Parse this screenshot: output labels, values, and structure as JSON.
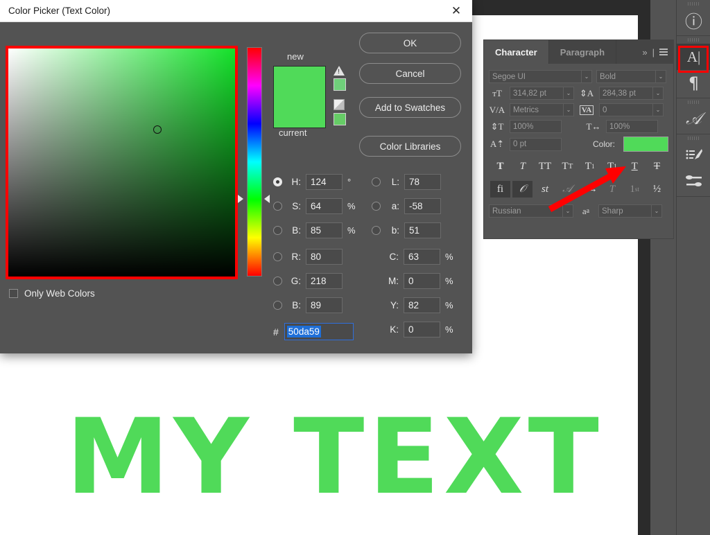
{
  "dialog": {
    "title": "Color Picker (Text Color)",
    "close_icon": "✕",
    "new_label": "new",
    "current_label": "current",
    "swatch_color": "#50da59",
    "buttons": [
      {
        "label": "OK",
        "name": "ok-button"
      },
      {
        "label": "Cancel",
        "name": "cancel-button"
      },
      {
        "label": "Add to Swatches",
        "name": "add-to-swatches-button"
      },
      {
        "label": "Color Libraries",
        "name": "color-libraries-button"
      }
    ],
    "hsb": [
      {
        "label": "H:",
        "value": "124",
        "unit": "°",
        "selected": true
      },
      {
        "label": "S:",
        "value": "64",
        "unit": "%",
        "selected": false
      },
      {
        "label": "B:",
        "value": "85",
        "unit": "%",
        "selected": false
      }
    ],
    "rgb": [
      {
        "label": "R:",
        "value": "80",
        "unit": "",
        "selected": false
      },
      {
        "label": "G:",
        "value": "218",
        "unit": "",
        "selected": false
      },
      {
        "label": "B:",
        "value": "89",
        "unit": "",
        "selected": false
      }
    ],
    "lab": [
      {
        "label": "L:",
        "value": "78",
        "unit": "",
        "selected": false
      },
      {
        "label": "a:",
        "value": "-58",
        "unit": "",
        "selected": false
      },
      {
        "label": "b:",
        "value": "51",
        "unit": "",
        "selected": false
      }
    ],
    "cmyk": [
      {
        "label": "C:",
        "value": "63",
        "unit": "%"
      },
      {
        "label": "M:",
        "value": "0",
        "unit": "%"
      },
      {
        "label": "Y:",
        "value": "82",
        "unit": "%"
      },
      {
        "label": "K:",
        "value": "0",
        "unit": "%"
      }
    ],
    "hex_symbol": "#",
    "hex_value": "50da59",
    "only_web_colors": "Only Web Colors",
    "only_web_colors_checked": false
  },
  "character_panel": {
    "tabs": [
      {
        "label": "Character",
        "selected": true
      },
      {
        "label": "Paragraph",
        "selected": false
      }
    ],
    "collapse_icon": "»",
    "divider": "|",
    "menu_icon": "menu-icon",
    "font_family": "Segoe UI",
    "font_style": "Bold",
    "font_size": "314,82 pt",
    "leading": "284,38 pt",
    "kerning": "Metrics",
    "tracking": "0",
    "vertical_scale": "100%",
    "horizontal_scale": "100%",
    "baseline_shift": "0 pt",
    "color_label": "Color:",
    "color_value": "#50da59",
    "language": "Russian",
    "antialias": "Sharp",
    "style_buttons_row1": [
      "T",
      "𝑇",
      "TT",
      "Tᴛ",
      "T¹",
      "T₁",
      "T",
      "T"
    ],
    "style_buttons_row2": [
      "fi",
      "𝒪",
      "st",
      "𝒜",
      "aa",
      "𝕋",
      "1st",
      "½"
    ],
    "caret_icon": "⌄"
  },
  "icon_rail": {
    "items": [
      {
        "name": "info-icon",
        "glyph": "ⓘ",
        "active": false
      },
      {
        "name": "character-panel-icon",
        "glyph": "A|",
        "active": true
      },
      {
        "name": "paragraph-panel-icon",
        "glyph": "¶",
        "active": false
      },
      {
        "name": "glyphs-panel-icon",
        "glyph": "𝒜",
        "active": false
      },
      {
        "name": "brush-settings-icon",
        "glyph": "brush",
        "active": false
      },
      {
        "name": "brush-presets-icon",
        "glyph": "presets",
        "active": false
      }
    ]
  },
  "canvas": {
    "text": "MY TEXT",
    "text_color": "#50da59"
  },
  "annotation": {
    "arrow_color": "#ff0000",
    "highlight_color": "#ff0000"
  }
}
